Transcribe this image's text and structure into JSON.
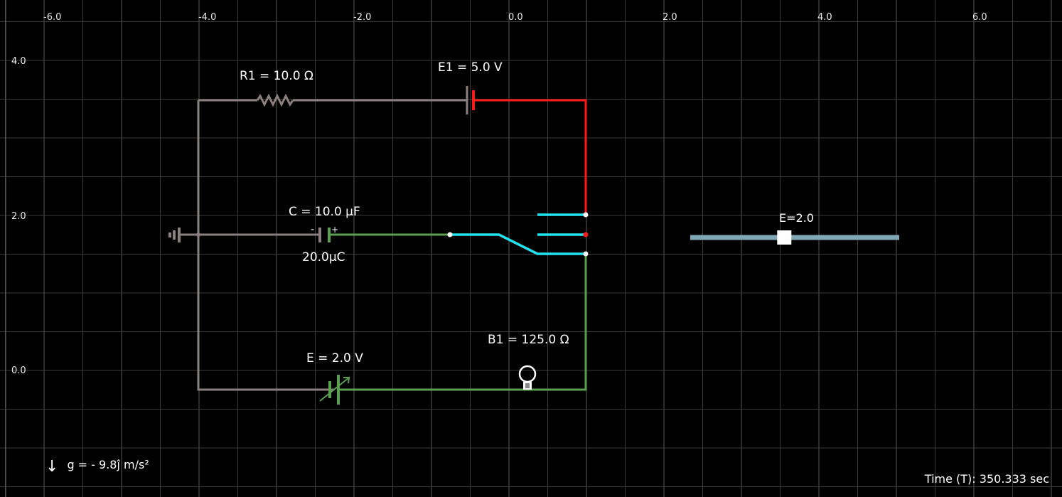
{
  "axes": {
    "x_ticks": [
      "-6.0",
      "-4.0",
      "-2.0",
      "0.0",
      "2.0",
      "4.0",
      "6.0"
    ],
    "y_ticks": [
      "4.0",
      "2.0",
      "0.0"
    ]
  },
  "components": {
    "resistor": {
      "label": "R1 = 10.0 Ω"
    },
    "battery": {
      "label": "E1 = 5.0 V"
    },
    "capacitor": {
      "label": "C = 10.0 µF",
      "charge": "20.0µC",
      "minus": "-",
      "plus": "+"
    },
    "variable_source": {
      "label": "E = 2.0 V"
    },
    "bulb": {
      "label": "B1 = 125.0 Ω"
    }
  },
  "slider": {
    "label": "E=2.0",
    "value_fraction": 0.45
  },
  "gravity": {
    "arrow": "↓",
    "text": "g =  - 9.8ĵ  m/s²"
  },
  "status": {
    "time": "Time (T): 350.333 sec"
  },
  "colors": {
    "wire_gray": "#8c7f7f",
    "wire_red": "#ff1a1a",
    "wire_green": "#5aa050",
    "wire_cyan": "#22e3f0",
    "slider_track": "#7fa8b4",
    "grid": "#3a3a3a"
  }
}
